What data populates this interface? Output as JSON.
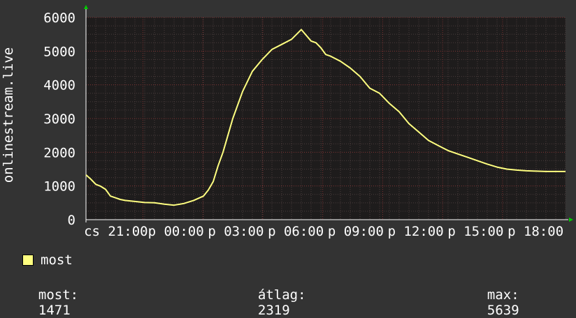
{
  "chart_data": {
    "type": "line",
    "ylabel": "onlinestream.live",
    "ylim": [
      0,
      6000
    ],
    "yticks": [
      0,
      1000,
      2000,
      3000,
      4000,
      5000,
      6000
    ],
    "xticks": [
      "cs 21:00",
      "p 00:00",
      "p 03:00",
      "p 06:00",
      "p 09:00",
      "p 12:00",
      "p 15:00",
      "p 18:00"
    ],
    "x_hours": [
      0,
      0.5,
      1,
      1.5,
      2,
      2.5,
      3,
      3.5,
      4,
      5,
      6,
      7,
      8,
      9,
      10,
      11,
      12,
      12.5,
      13,
      13.5,
      14,
      14.5,
      15,
      16,
      17,
      18,
      19,
      20,
      21,
      22,
      23,
      23.5,
      24,
      24.5,
      25,
      26,
      27,
      28,
      29,
      30,
      31,
      32,
      33,
      34,
      35,
      36,
      37,
      38,
      39,
      40,
      41,
      42,
      43,
      44,
      45,
      46,
      47,
      48,
      49
    ],
    "series": [
      {
        "name": "most",
        "color": "#ffff80",
        "values": [
          1330,
          1200,
          1050,
          990,
          900,
          700,
          650,
          600,
          570,
          540,
          510,
          500,
          460,
          430,
          480,
          570,
          700,
          880,
          1130,
          1600,
          2000,
          2500,
          3000,
          3800,
          4400,
          4750,
          5050,
          5200,
          5350,
          5639,
          5300,
          5250,
          5100,
          4900,
          4850,
          4700,
          4500,
          4250,
          3900,
          3750,
          3450,
          3200,
          2850,
          2600,
          2350,
          2200,
          2050,
          1950,
          1850,
          1750,
          1650,
          1560,
          1500,
          1471,
          1450,
          1440,
          1430,
          1430,
          1430
        ]
      }
    ]
  },
  "legend": {
    "label": "most",
    "color": "#ffff80"
  },
  "stats": {
    "current_label": "most:",
    "current_value": "1471",
    "avg_label": "átlag:",
    "avg_value": "2319",
    "max_label": "max:",
    "max_value": "5639"
  }
}
